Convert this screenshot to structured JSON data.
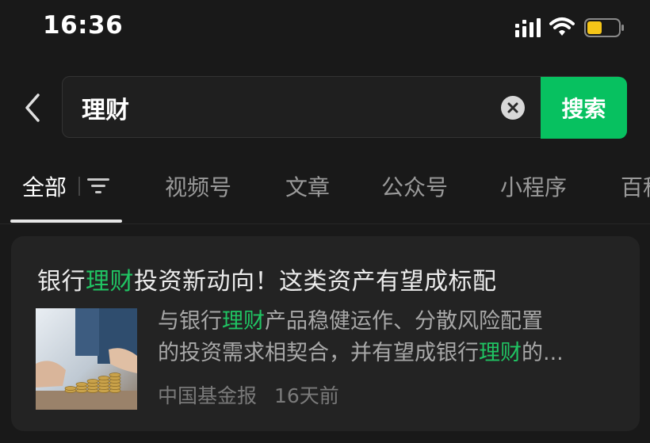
{
  "status_bar": {
    "time": "16:36",
    "battery_color": "#f5c518"
  },
  "search": {
    "query": "理财",
    "button_label": "搜索"
  },
  "tabs": [
    {
      "label": "全部",
      "active": true
    },
    {
      "label": "视频号"
    },
    {
      "label": "文章"
    },
    {
      "label": "公众号"
    },
    {
      "label": "小程序"
    },
    {
      "label": "百科"
    }
  ],
  "result": {
    "title": {
      "pre": "银行",
      "hl": "理财",
      "post": "投资新动向！这类资产有望成标配"
    },
    "snippet": {
      "line1_pre": "与银行",
      "line1_hl": "理财",
      "line1_post": "产品稳健运作、分散风险配置",
      "line2_pre": "的投资需求相契合，并有望成银行",
      "line2_hl": "理财",
      "line2_post": "的..."
    },
    "source": "中国基金报",
    "time": "16天前"
  },
  "colors": {
    "accent": "#07c160",
    "highlight": "#20c463",
    "background": "#191919"
  },
  "icons": [
    "signal-icon",
    "wifi-icon",
    "battery-icon",
    "back-arrow-icon",
    "clear-icon",
    "filter-icon",
    "coin-stack-thumbnail"
  ]
}
